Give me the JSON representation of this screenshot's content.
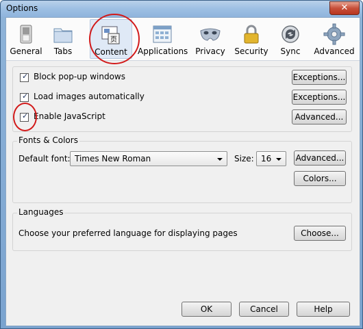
{
  "window": {
    "title": "Options",
    "close_label": "✕"
  },
  "tabs": [
    {
      "label": "General",
      "icon": "switch-icon"
    },
    {
      "label": "Tabs",
      "icon": "folder-tabs-icon"
    },
    {
      "label": "Content",
      "icon": "content-page-icon",
      "selected": true
    },
    {
      "label": "Applications",
      "icon": "applications-icon"
    },
    {
      "label": "Privacy",
      "icon": "mask-icon"
    },
    {
      "label": "Security",
      "icon": "padlock-icon"
    },
    {
      "label": "Sync",
      "icon": "sync-icon"
    },
    {
      "label": "Advanced",
      "icon": "gear-icon"
    }
  ],
  "content": {
    "block_popups": {
      "label": "Block pop-up windows",
      "checked": true,
      "button": "Exceptions..."
    },
    "load_images": {
      "label": "Load images automatically",
      "checked": true,
      "button": "Exceptions..."
    },
    "enable_js": {
      "label": "Enable JavaScript",
      "checked": true,
      "button": "Advanced..."
    }
  },
  "fonts": {
    "group_label": "Fonts & Colors",
    "default_font_label": "Default font:",
    "default_font_value": "Times New Roman",
    "size_label": "Size:",
    "size_value": "16",
    "advanced_button": "Advanced...",
    "colors_button": "Colors..."
  },
  "languages": {
    "group_label": "Languages",
    "description": "Choose your preferred language for displaying pages",
    "choose_button": "Choose..."
  },
  "footer": {
    "ok": "OK",
    "cancel": "Cancel",
    "help": "Help"
  },
  "colors": {
    "annotation": "#d21a1a",
    "selected_tab": "#dfe9f6",
    "titlebar": "#9dbfe3"
  }
}
